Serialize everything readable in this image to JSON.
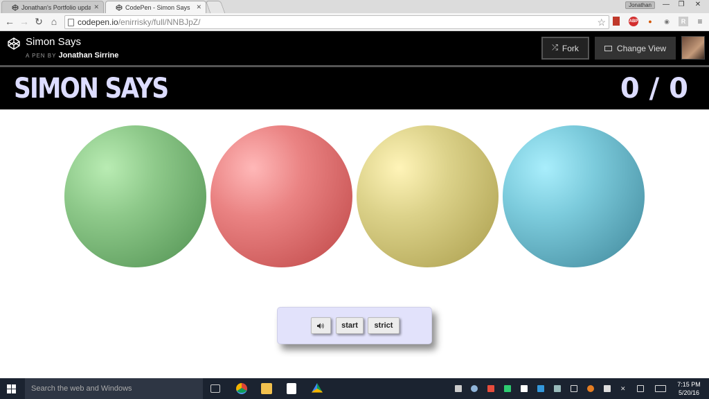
{
  "browser": {
    "tabs": [
      {
        "title": "Jonathan's Portfolio upda",
        "active": false
      },
      {
        "title": "CodePen - Simon Says",
        "active": true
      }
    ],
    "user_chip": "Jonathan",
    "window_controls": {
      "minimize": "—",
      "maximize": "❐",
      "close": "✕"
    },
    "url_domain": "codepen.io",
    "url_path": "/enirrisky/full/NNBJpZ/"
  },
  "codepen": {
    "title": "Simon Says",
    "byline_prefix": "A PEN BY",
    "author": "Jonathan Sirrine",
    "fork_label": "Fork",
    "change_view_label": "Change View"
  },
  "game": {
    "title": "SIMON SAYS",
    "score": "0 / 0",
    "pads": [
      {
        "color_name": "green",
        "color": "#8ec98a"
      },
      {
        "color_name": "red",
        "color": "#ea8383"
      },
      {
        "color_name": "yellow",
        "color": "#dcd28a"
      },
      {
        "color_name": "blue",
        "color": "#7ccbdc"
      }
    ],
    "controls": {
      "sound_icon": "speaker-icon",
      "start_label": "start",
      "strict_label": "strict"
    }
  },
  "taskbar": {
    "search_placeholder": "Search the web and Windows",
    "time": "7:15 PM",
    "date": "5/20/16"
  },
  "colors": {
    "header_bg": "#000000",
    "title_text": "#dcdcff",
    "controls_bg": "#e2e2fb",
    "taskbar_bg": "#1b2330"
  }
}
